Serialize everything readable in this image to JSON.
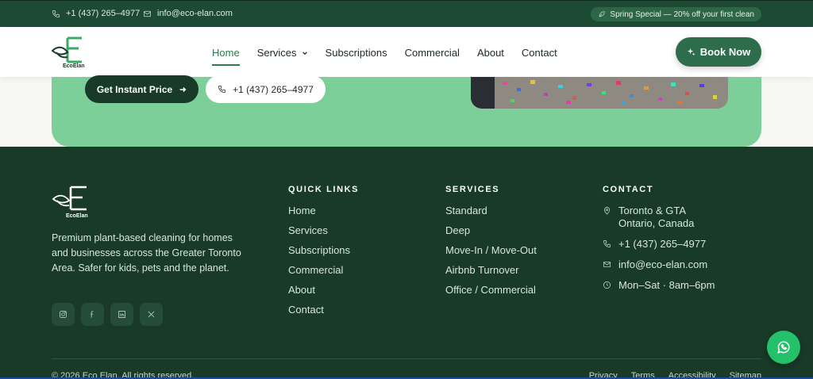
{
  "topbar": {
    "phone": "+1 (437) 265–4977",
    "email": "info@eco-elan.com",
    "promo": "Spring Special — 20% off your first clean"
  },
  "header": {
    "logo_text": "EcoElan",
    "nav": [
      "Home",
      "Services",
      "Subscriptions",
      "Commercial",
      "About",
      "Contact"
    ],
    "active_index": 0,
    "book_button": "Book Now"
  },
  "hero": {
    "instant_price_button": "Get Instant Price",
    "phone_button": "+1 (437) 265–4977"
  },
  "footer": {
    "logo_text": "EcoElan",
    "description": "Premium plant-based cleaning for homes and businesses across the Greater Toronto Area. Safer for kids, pets and the planet.",
    "socials": [
      "instagram-icon",
      "facebook-icon",
      "linkedin-icon",
      "x-icon"
    ],
    "quick_links": {
      "title": "QUICK LINKS",
      "items": [
        "Home",
        "Services",
        "Subscriptions",
        "Commercial",
        "About",
        "Contact"
      ]
    },
    "services": {
      "title": "SERVICES",
      "items": [
        "Standard",
        "Deep",
        "Move-In / Move-Out",
        "Airbnb Turnover",
        "Office / Commercial"
      ]
    },
    "contact": {
      "title": "CONTACT",
      "address_line1": "Toronto & GTA",
      "address_line2": "Ontario, Canada",
      "phone": "+1 (437) 265–4977",
      "email": "info@eco-elan.com",
      "hours": "Mon–Sat · 8am–6pm"
    },
    "copyright": "© 2026 Eco Elan. All rights reserved.",
    "legal": [
      "Privacy",
      "Terms",
      "Accessibility",
      "Sitemap"
    ]
  },
  "colors": {
    "dark_green": "#183a27",
    "accent_green": "#2d6d4b",
    "hero_green": "#7ccf98",
    "whatsapp": "#25c16a"
  }
}
